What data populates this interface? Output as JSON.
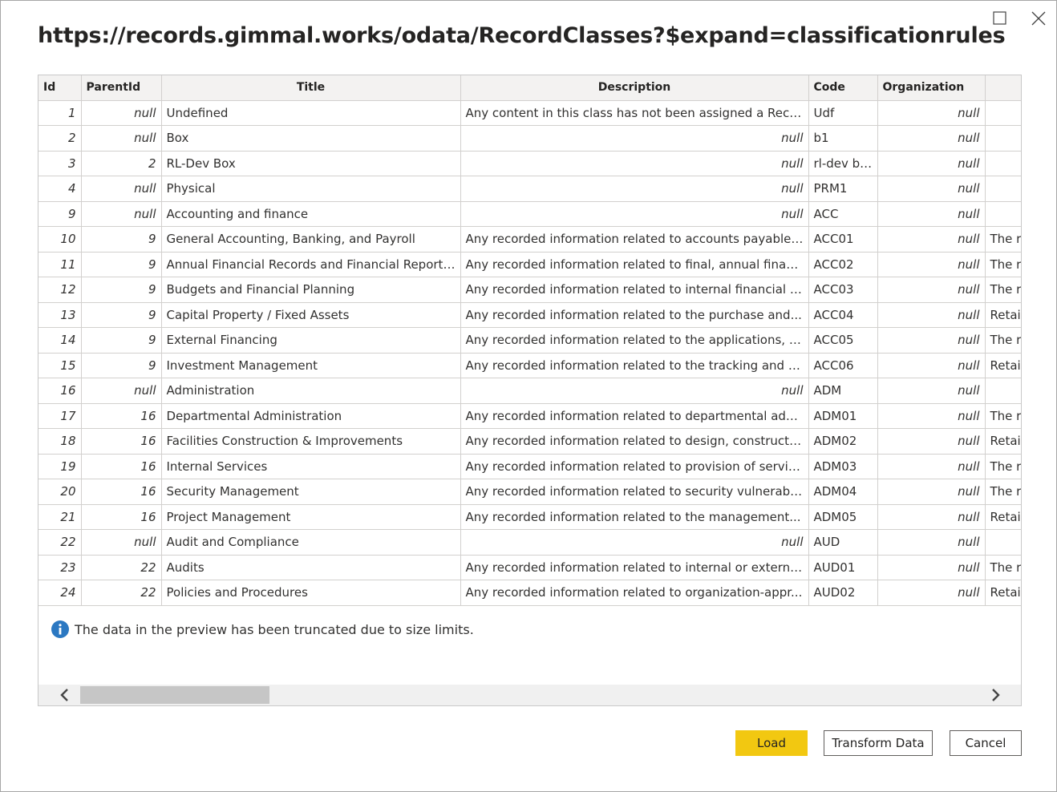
{
  "window": {
    "title": "https://records.gimmal.works/odata/RecordClasses?$expand=classificationrules",
    "maximize_icon": "maximize-icon",
    "close_icon": "close-icon"
  },
  "table": {
    "columns": [
      "Id",
      "ParentId",
      "Title",
      "Description",
      "Code",
      "Organization",
      ""
    ],
    "rows": [
      {
        "id": "1",
        "parent": "null",
        "title": "Undefined",
        "desc": "Any content in this class has not been assigned a Record Class",
        "desc_null": false,
        "code": "Udf",
        "org": "null",
        "extra": ""
      },
      {
        "id": "2",
        "parent": "null",
        "title": "Box",
        "desc": "null",
        "desc_null": true,
        "code": "b1",
        "org": "null",
        "extra": ""
      },
      {
        "id": "3",
        "parent": "2",
        "title": "RL-Dev Box",
        "desc": "null",
        "desc_null": true,
        "code": "rl-dev box",
        "org": "null",
        "extra": ""
      },
      {
        "id": "4",
        "parent": "null",
        "title": "Physical",
        "desc": "null",
        "desc_null": true,
        "code": "PRM1",
        "org": "null",
        "extra": ""
      },
      {
        "id": "9",
        "parent": "null",
        "title": "Accounting and finance",
        "desc": "null",
        "desc_null": true,
        "code": "ACC",
        "org": "null",
        "extra": ""
      },
      {
        "id": "10",
        "parent": "9",
        "title": "General Accounting, Banking, and Payroll",
        "desc": "Any recorded information related to accounts payable,...",
        "desc_null": false,
        "code": "ACC01",
        "org": "null",
        "extra": "The r"
      },
      {
        "id": "11",
        "parent": "9",
        "title": "Annual Financial Records and Financial Reporting",
        "desc": "Any recorded information related to final, annual finan...",
        "desc_null": false,
        "code": "ACC02",
        "org": "null",
        "extra": "The r"
      },
      {
        "id": "12",
        "parent": "9",
        "title": "Budgets and Financial Planning",
        "desc": "Any recorded information related to internal financial p...",
        "desc_null": false,
        "code": "ACC03",
        "org": "null",
        "extra": "The r"
      },
      {
        "id": "13",
        "parent": "9",
        "title": "Capital Property / Fixed Assets",
        "desc": "Any recorded information related to the purchase and...",
        "desc_null": false,
        "code": "ACC04",
        "org": "null",
        "extra": "Retai"
      },
      {
        "id": "14",
        "parent": "9",
        "title": "External Financing",
        "desc": "Any recorded information related to the applications, is...",
        "desc_null": false,
        "code": "ACC05",
        "org": "null",
        "extra": "The r"
      },
      {
        "id": "15",
        "parent": "9",
        "title": "Investment Management",
        "desc": "Any recorded information related to the tracking and m...",
        "desc_null": false,
        "code": "ACC06",
        "org": "null",
        "extra": "Retai"
      },
      {
        "id": "16",
        "parent": "null",
        "title": "Administration",
        "desc": "null",
        "desc_null": true,
        "code": "ADM",
        "org": "null",
        "extra": ""
      },
      {
        "id": "17",
        "parent": "16",
        "title": "Departmental Administration",
        "desc": "Any recorded information related to departmental adm...",
        "desc_null": false,
        "code": "ADM01",
        "org": "null",
        "extra": "The r"
      },
      {
        "id": "18",
        "parent": "16",
        "title": "Facilities Construction & Improvements",
        "desc": "Any recorded information related to design, constructi...",
        "desc_null": false,
        "code": "ADM02",
        "org": "null",
        "extra": "Retai"
      },
      {
        "id": "19",
        "parent": "16",
        "title": "Internal Services",
        "desc": "Any recorded information related to provision of servic...",
        "desc_null": false,
        "code": "ADM03",
        "org": "null",
        "extra": "The r"
      },
      {
        "id": "20",
        "parent": "16",
        "title": "Security Management",
        "desc": "Any recorded information related to security vulnerabil...",
        "desc_null": false,
        "code": "ADM04",
        "org": "null",
        "extra": "The r"
      },
      {
        "id": "21",
        "parent": "16",
        "title": "Project Management",
        "desc": "Any recorded information related to the management...",
        "desc_null": false,
        "code": "ADM05",
        "org": "null",
        "extra": "Retai"
      },
      {
        "id": "22",
        "parent": "null",
        "title": "Audit and Compliance",
        "desc": "null",
        "desc_null": true,
        "code": "AUD",
        "org": "null",
        "extra": ""
      },
      {
        "id": "23",
        "parent": "22",
        "title": "Audits",
        "desc": "Any recorded information related to internal or externa...",
        "desc_null": false,
        "code": "AUD01",
        "org": "null",
        "extra": "The r"
      },
      {
        "id": "24",
        "parent": "22",
        "title": "Policies and Procedures",
        "desc": "Any recorded information related to organization-appr...",
        "desc_null": false,
        "code": "AUD02",
        "org": "null",
        "extra": "Retai"
      }
    ]
  },
  "notice": {
    "icon": "info-icon",
    "text": "The data in the preview has been truncated due to size limits."
  },
  "scrollbar": {
    "left_icon": "chevron-left-icon",
    "right_icon": "chevron-right-icon"
  },
  "buttons": {
    "load": "Load",
    "transform": "Transform Data",
    "cancel": "Cancel"
  },
  "colors": {
    "accent": "#f2c811",
    "info": "#2b78c2"
  }
}
